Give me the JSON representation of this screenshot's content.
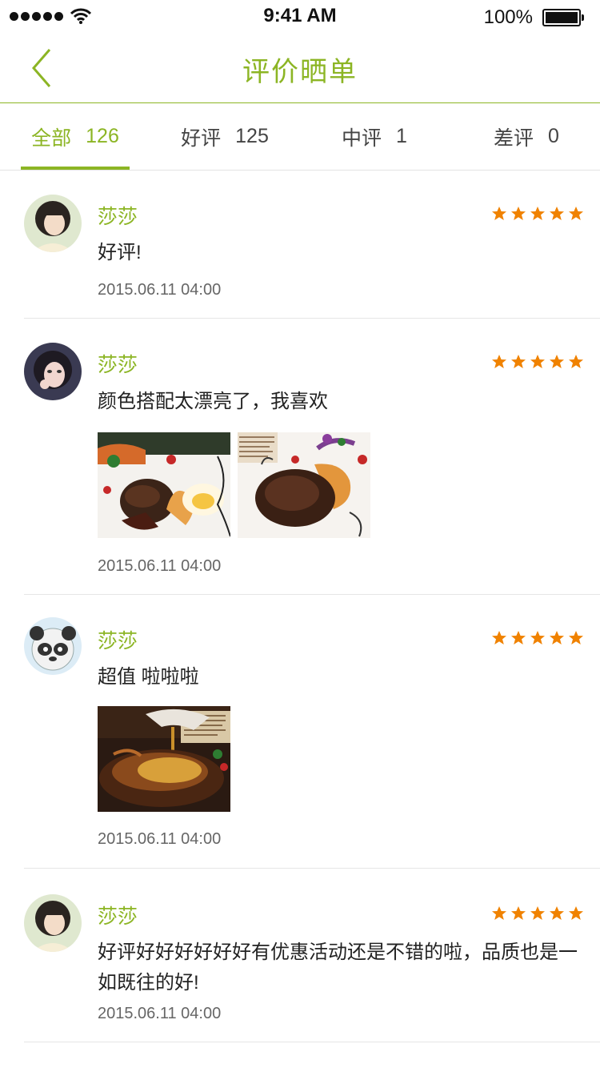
{
  "status_bar": {
    "time": "9:41 AM",
    "battery": "100%"
  },
  "nav": {
    "title": "评价晒单"
  },
  "tabs": [
    {
      "label": "全部",
      "count": "126"
    },
    {
      "label": "好评",
      "count": "125"
    },
    {
      "label": "中评",
      "count": "1"
    },
    {
      "label": "差评",
      "count": "0"
    }
  ],
  "reviews": [
    {
      "name": "莎莎",
      "rating": 5,
      "text": "好评!",
      "date": "2015.06.11 04:00"
    },
    {
      "name": "莎莎",
      "rating": 5,
      "text": "颜色搭配太漂亮了，我喜欢",
      "date": "2015.06.11 04:00"
    },
    {
      "name": "莎莎",
      "rating": 5,
      "text": "超值 啦啦啦",
      "date": "2015.06.11 04:00"
    },
    {
      "name": "莎莎",
      "rating": 5,
      "text": "好评好好好好好好有优惠活动还是不错的啦，品质也是一如既往的好!",
      "date": "2015.06.11 04:00"
    }
  ],
  "colors": {
    "accent": "#8cb524",
    "star": "#f08200"
  }
}
